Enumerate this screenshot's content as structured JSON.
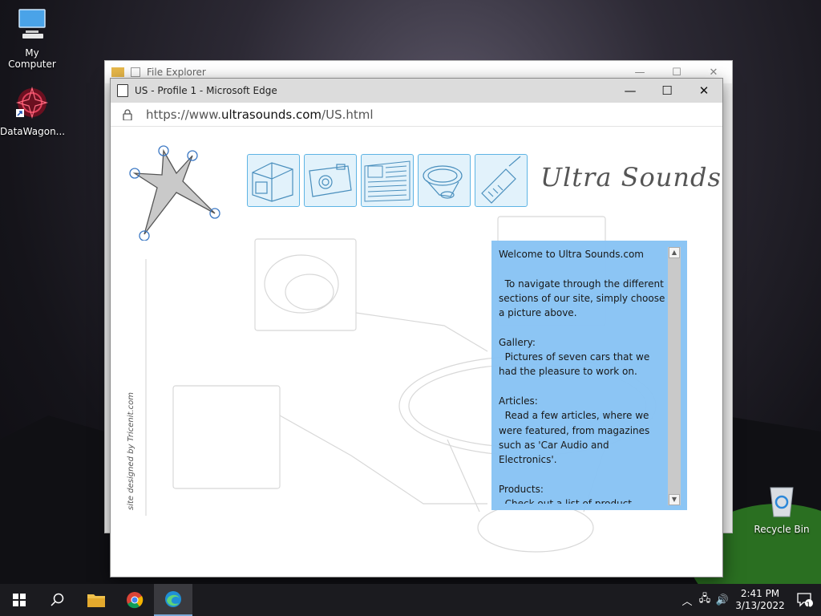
{
  "desktop": {
    "icons": [
      {
        "label": "My Computer"
      },
      {
        "label": "DataWagon..."
      },
      {
        "label": "Recycle Bin"
      }
    ]
  },
  "explorer": {
    "title": "File Explorer"
  },
  "edge": {
    "tab_title": "US - Profile 1 - Microsoft Edge",
    "url_prefix": "https://www.",
    "url_domain": "ultrasounds.com",
    "url_path": "/US.html"
  },
  "site": {
    "logo": "Ultra Sounds",
    "credit": "site designed by Tricenit.com",
    "nav": [
      "house",
      "camera",
      "newspaper",
      "speaker",
      "phone"
    ],
    "info": {
      "welcome": "Welcome to Ultra Sounds.com",
      "intro": "  To navigate through the different sections of our site, simply choose a picture above.",
      "gallery_h": "Gallery:",
      "gallery": "  Pictures of seven cars that we had the pleasure to work on.",
      "articles_h": "Articles:",
      "articles": "  Read a few articles, where we were featured, from magazines such as 'Car Audio and Electronics'.",
      "products_h": "Products:",
      "products": "  Check out a list of product brands that we deal primarily with."
    }
  },
  "taskbar": {
    "time": "2:41 PM",
    "date": "3/13/2022",
    "notifications": "1"
  }
}
